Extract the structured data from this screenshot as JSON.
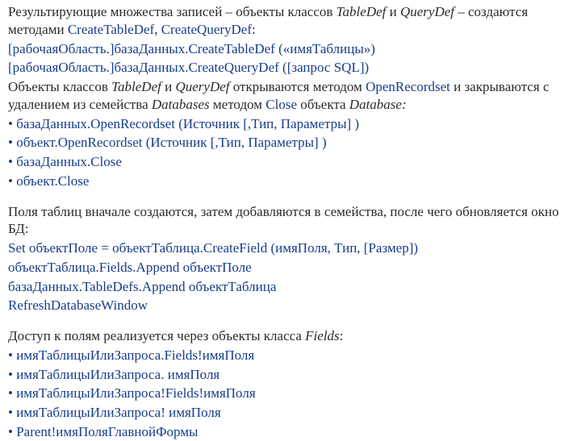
{
  "p1": {
    "t1": "Результирующие множества записей – объекты классов ",
    "i1": "TableDef",
    "t2": " и ",
    "i2": "QueryDef",
    "t3": " – создаются методами ",
    "b1": "CreateTableDef",
    "t4": ", ",
    "b2": "CreateQueryDef",
    "t5": ":"
  },
  "code1": {
    "l1": "[рабочаяОбласть.]базаДанных.CreateTableDef («имяТаблицы»)",
    "l2": "[рабочаяОбласть.]базаДанных.CreateQueryDef ([запрос SQL])"
  },
  "p2": {
    "t1": "Объекты классов ",
    "i1": "TableDef",
    "t2": " и ",
    "i2": "QueryDef",
    "t3": " открываются методом ",
    "b1": "OpenRecordset",
    "t4": " и закрываются с удалением из семейства ",
    "i3": "Databases",
    "t5": " методом ",
    "b2": "Close",
    "t6": " объекта ",
    "i4": "Database:"
  },
  "list1": {
    "l1": "• базаДанных.OpenRecordset (Источник [,Тип, Параметры] )",
    "l2": "• объект.OpenRecordset (Источник [,Тип, Параметры] )",
    "l3": "• базаДанных.Close",
    "l4": "• объект.Close"
  },
  "p3": {
    "t1": "Поля таблиц вначале создаются, затем добавляются в семейства, после чего обновляется окно БД:"
  },
  "code2": {
    "l1": "Set объектПоле = объектТаблица.CreateField (имяПоля, Тип, [Размер])",
    "l2": "объектТаблица.Fields.Append объектПоле",
    "l3": "базаДанных.TableDefs.Append объектТаблица",
    "l4": "RefreshDatabaseWindow"
  },
  "p4": {
    "t1": "Доступ к полям реализуется через объекты класса ",
    "i1": "Fields",
    "t2": ":"
  },
  "list2": {
    "l1": "• имяТаблицыИлиЗапроса.Fields!имяПоля",
    "l2": "• имяТаблицыИлиЗапроса. имяПоля",
    "l3": "• имяТаблицыИлиЗапроса!Fields!имяПоля",
    "l4": "• имяТаблицыИлиЗапроса! имяПоля",
    "l5": "• Parent!имяПоляГлавнойФормы"
  }
}
